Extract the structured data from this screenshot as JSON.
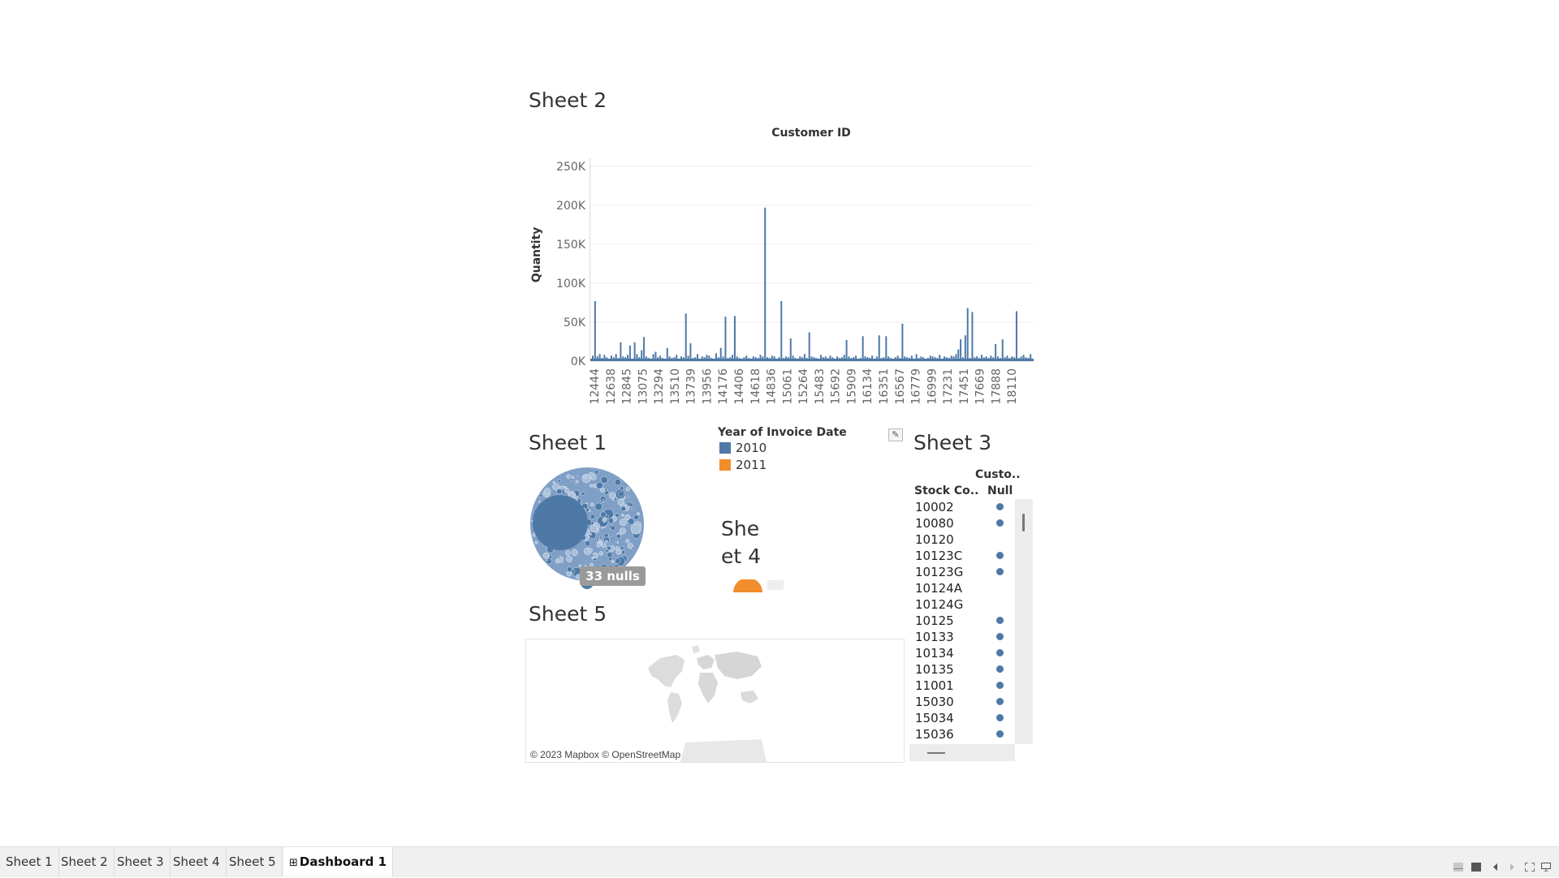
{
  "sheet2": {
    "title": "Sheet 2",
    "chart_data": {
      "type": "bar",
      "title": "Customer ID",
      "xlabel": "",
      "ylabel": "Quantity",
      "ylim": [
        0,
        250000
      ],
      "y_ticks": [
        "0K",
        "50K",
        "100K",
        "150K",
        "200K",
        "250K"
      ],
      "y_tick_values": [
        0,
        50000,
        100000,
        150000,
        200000,
        250000
      ],
      "x_tick_labels": [
        "12444",
        "12638",
        "12845",
        "13075",
        "13294",
        "13510",
        "13739",
        "13956",
        "14176",
        "14406",
        "14618",
        "14836",
        "15061",
        "15264",
        "15483",
        "15692",
        "15909",
        "16134",
        "16351",
        "16567",
        "16779",
        "16999",
        "17231",
        "17451",
        "17669",
        "17888",
        "18110"
      ],
      "series": [
        {
          "color": "#4e79a7",
          "values": [
            7000,
            77000,
            6000,
            9000,
            4000,
            8000,
            5000,
            3000,
            7000,
            5000,
            9000,
            4000,
            24000,
            6000,
            5000,
            8000,
            20000,
            3000,
            24000,
            9000,
            5000,
            14000,
            31000,
            6000,
            4000,
            3000,
            9000,
            12000,
            5000,
            7000,
            4000,
            3000,
            17000,
            6000,
            4000,
            5000,
            8000,
            3000,
            6000,
            5000,
            61000,
            7000,
            23000,
            4000,
            5000,
            9000,
            3000,
            6000,
            5000,
            8000,
            7000,
            4000,
            3000,
            10000,
            5000,
            17000,
            6000,
            57000,
            4000,
            5000,
            8000,
            58000,
            6000,
            4000,
            3000,
            5000,
            7000,
            4000,
            3000,
            6000,
            5000,
            4000,
            8000,
            6000,
            197000,
            5000,
            4000,
            7000,
            6000,
            3000,
            5000,
            77000,
            4000,
            6000,
            5000,
            29000,
            7000,
            4000,
            3000,
            6000,
            5000,
            9000,
            4000,
            37000,
            6000,
            5000,
            4000,
            3000,
            8000,
            5000,
            6000,
            4000,
            7000,
            5000,
            3000,
            6000,
            4000,
            5000,
            8000,
            27000,
            6000,
            4000,
            5000,
            7000,
            3000,
            4000,
            32000,
            6000,
            5000,
            4000,
            7000,
            3000,
            6000,
            33000,
            4000,
            5000,
            32000,
            6000,
            4000,
            3000,
            5000,
            7000,
            4000,
            48000,
            6000,
            5000,
            4000,
            7000,
            3000,
            9000,
            4000,
            6000,
            5000,
            3000,
            4000,
            7000,
            6000,
            5000,
            4000,
            8000,
            3000,
            6000,
            5000,
            4000,
            7000,
            6000,
            9000,
            15000,
            28000,
            5000,
            33000,
            68000,
            4000,
            63000,
            5000,
            6000,
            4000,
            8000,
            5000,
            6000,
            4000,
            7000,
            5000,
            22000,
            6000,
            4000,
            28000,
            5000,
            7000,
            4000,
            6000,
            5000,
            64000,
            4000,
            6000,
            8000,
            5000,
            4000,
            9000
          ]
        }
      ]
    }
  },
  "legend": {
    "title": "Year of Invoice Date",
    "items": [
      {
        "label": "2010",
        "color": "#4e79a7"
      },
      {
        "label": "2011",
        "color": "#f28e2b"
      }
    ]
  },
  "sheet1": {
    "title": "Sheet 1",
    "nulls_label": "33 nulls"
  },
  "sheet4": {
    "title": "She\net 4"
  },
  "sheet3": {
    "title": "Sheet 3",
    "col_header_top": "Custo..",
    "col_header_null": "Null",
    "col_header_stock": "Stock Co..",
    "rows": [
      {
        "code": "10002",
        "dot": true
      },
      {
        "code": "10080",
        "dot": true
      },
      {
        "code": "10120",
        "dot": false
      },
      {
        "code": "10123C",
        "dot": true
      },
      {
        "code": "10123G",
        "dot": true
      },
      {
        "code": "10124A",
        "dot": false
      },
      {
        "code": "10124G",
        "dot": false
      },
      {
        "code": "10125",
        "dot": true
      },
      {
        "code": "10133",
        "dot": true
      },
      {
        "code": "10134",
        "dot": true
      },
      {
        "code": "10135",
        "dot": true
      },
      {
        "code": "11001",
        "dot": true
      },
      {
        "code": "15030",
        "dot": true
      },
      {
        "code": "15034",
        "dot": true
      },
      {
        "code": "15036",
        "dot": true
      }
    ]
  },
  "sheet5": {
    "title": "Sheet 5",
    "map_credit": "© 2023 Mapbox © OpenStreetMap"
  },
  "tabs": [
    {
      "label": "Sheet 1",
      "active": false,
      "icon": ""
    },
    {
      "label": "Sheet 2",
      "active": false,
      "icon": ""
    },
    {
      "label": "Sheet 3",
      "active": false,
      "icon": ""
    },
    {
      "label": "Sheet 4",
      "active": false,
      "icon": ""
    },
    {
      "label": "Sheet 5",
      "active": false,
      "icon": ""
    },
    {
      "label": "Dashboard 1",
      "active": true,
      "icon": "dashboard-grid-icon"
    }
  ],
  "toolbar_icons": [
    "show-sheets-icon",
    "filmstrip-icon",
    "prev-icon",
    "next-icon",
    "fit-icon",
    "present-icon"
  ]
}
